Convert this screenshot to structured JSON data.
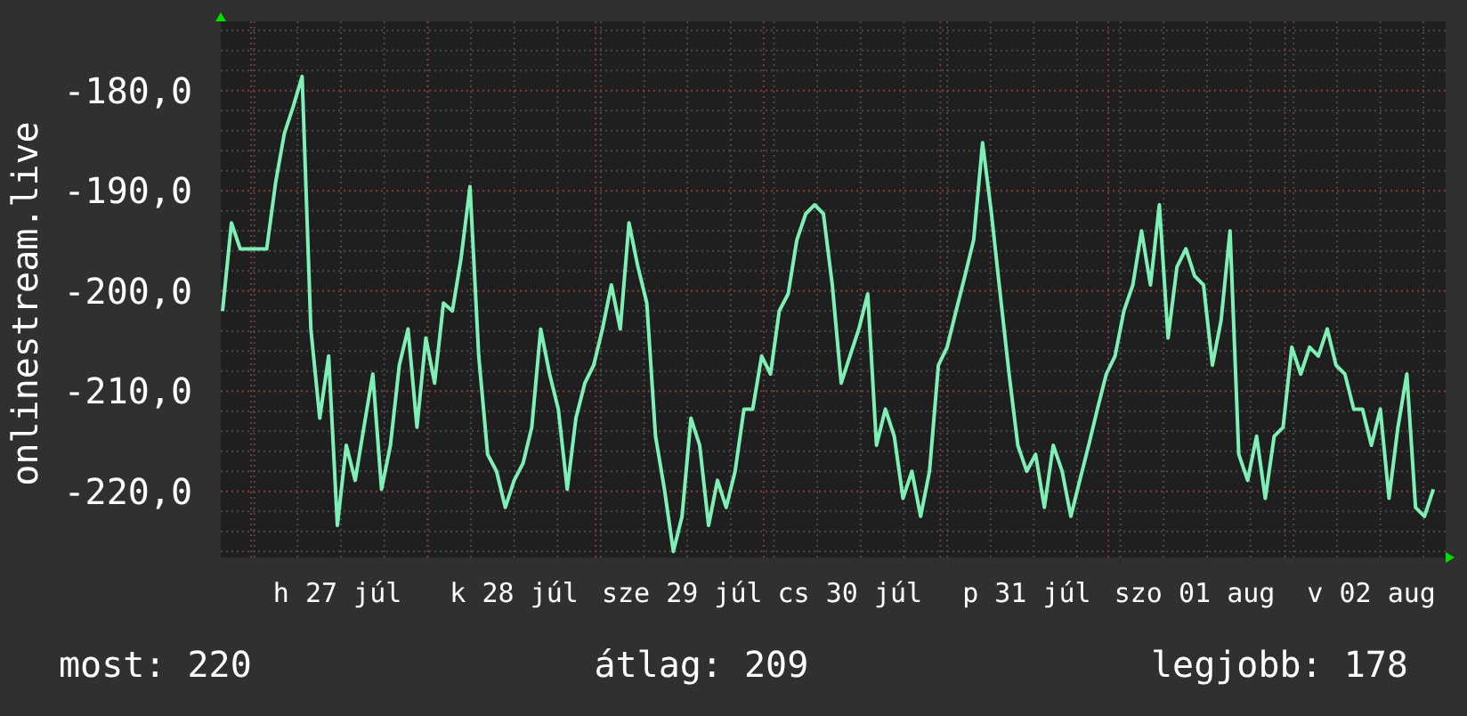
{
  "chart": {
    "chart_data": {
      "type": "line",
      "ylabel": "onlinestream.live",
      "categories": [
        null,
        null,
        null,
        null,
        null,
        null,
        null,
        null,
        null,
        null,
        null,
        null,
        null,
        "h 27 júl",
        null,
        null,
        null,
        null,
        null,
        null,
        null,
        null,
        null,
        null,
        null,
        null,
        null,
        null,
        null,
        null,
        null,
        null,
        null,
        "k 28 júl",
        null,
        null,
        null,
        null,
        null,
        null,
        null,
        null,
        null,
        null,
        null,
        null,
        null,
        null,
        null,
        null,
        null,
        null,
        "sze 29 júl",
        null,
        null,
        null,
        null,
        null,
        null,
        null,
        null,
        null,
        null,
        null,
        null,
        null,
        null,
        null,
        null,
        null,
        null,
        "cs 30 júl",
        null,
        null,
        null,
        null,
        null,
        null,
        null,
        null,
        null,
        null,
        null,
        null,
        null,
        null,
        null,
        null,
        null,
        null,
        null,
        "p 31 júl",
        null,
        null,
        null,
        null,
        null,
        null,
        null,
        null,
        null,
        null,
        null,
        null,
        null,
        null,
        null,
        null,
        null,
        null,
        "szo 01 aug",
        null,
        null,
        null,
        null,
        null,
        null,
        null,
        null,
        null,
        null,
        null,
        null,
        null,
        null,
        null,
        null,
        null,
        null,
        null,
        "v 02 aug",
        null,
        null,
        null,
        null,
        null,
        null,
        null
      ],
      "series": [
        {
          "color": "#7ef0b5",
          "values": [
            -202.0,
            -193.2,
            -195.8,
            -195.8,
            -195.8,
            -195.8,
            -189.2,
            -184.3,
            -181.6,
            -178.6,
            -203.8,
            -212.7,
            -206.5,
            -223.4,
            -215.4,
            -218.9,
            -213.6,
            -208.3,
            -219.8,
            -215.4,
            -207.4,
            -203.8,
            -213.6,
            -204.7,
            -209.2,
            -201.2,
            -202.0,
            -196.7,
            -189.6,
            -206.5,
            -216.3,
            -218.0,
            -221.6,
            -218.9,
            -217.2,
            -213.6,
            -203.8,
            -208.3,
            -211.8,
            -219.8,
            -212.7,
            -209.2,
            -207.4,
            -203.8,
            -199.4,
            -203.8,
            -193.2,
            -197.6,
            -201.2,
            -214.5,
            -219.8,
            -226.0,
            -222.5,
            -212.7,
            -215.4,
            -223.4,
            -218.9,
            -221.6,
            -218.0,
            -211.8,
            -211.8,
            -206.5,
            -208.3,
            -202.0,
            -200.3,
            -194.9,
            -192.3,
            -191.4,
            -192.3,
            -199.4,
            -209.2,
            -206.5,
            -203.8,
            -200.3,
            -215.4,
            -211.8,
            -214.5,
            -220.7,
            -218.0,
            -222.5,
            -218.0,
            -207.4,
            -205.6,
            -202.0,
            -198.5,
            -194.9,
            -185.2,
            -192.3,
            -200.3,
            -208.3,
            -215.4,
            -218.0,
            -216.3,
            -221.6,
            -215.4,
            -218.0,
            -222.5,
            -218.9,
            -215.4,
            -211.8,
            -208.3,
            -206.5,
            -202.0,
            -199.4,
            -194.0,
            -199.4,
            -191.4,
            -204.7,
            -197.6,
            -195.8,
            -198.5,
            -199.4,
            -207.4,
            -202.9,
            -194.0,
            -216.3,
            -218.9,
            -214.5,
            -220.7,
            -214.5,
            -213.6,
            -205.6,
            -208.3,
            -205.6,
            -206.5,
            -203.8,
            -207.4,
            -208.3,
            -211.8,
            -211.8,
            -215.4,
            -211.8,
            -220.7,
            -213.6,
            -208.3,
            -221.6,
            -222.5,
            -219.8
          ]
        }
      ],
      "grid": true,
      "ylim": [
        -226.6,
        -173.1
      ],
      "yticks": [
        {
          "value": -180,
          "label": "-180,0"
        },
        {
          "value": -190,
          "label": "-190,0"
        },
        {
          "value": -200,
          "label": "-200,0"
        },
        {
          "value": -210,
          "label": "-210,0"
        },
        {
          "value": -220,
          "label": "-220,0"
        }
      ]
    }
  },
  "stats": [
    {
      "label": "most: 220"
    },
    {
      "label": "átlag: 209"
    },
    {
      "label": "legjobb: 178"
    }
  ]
}
